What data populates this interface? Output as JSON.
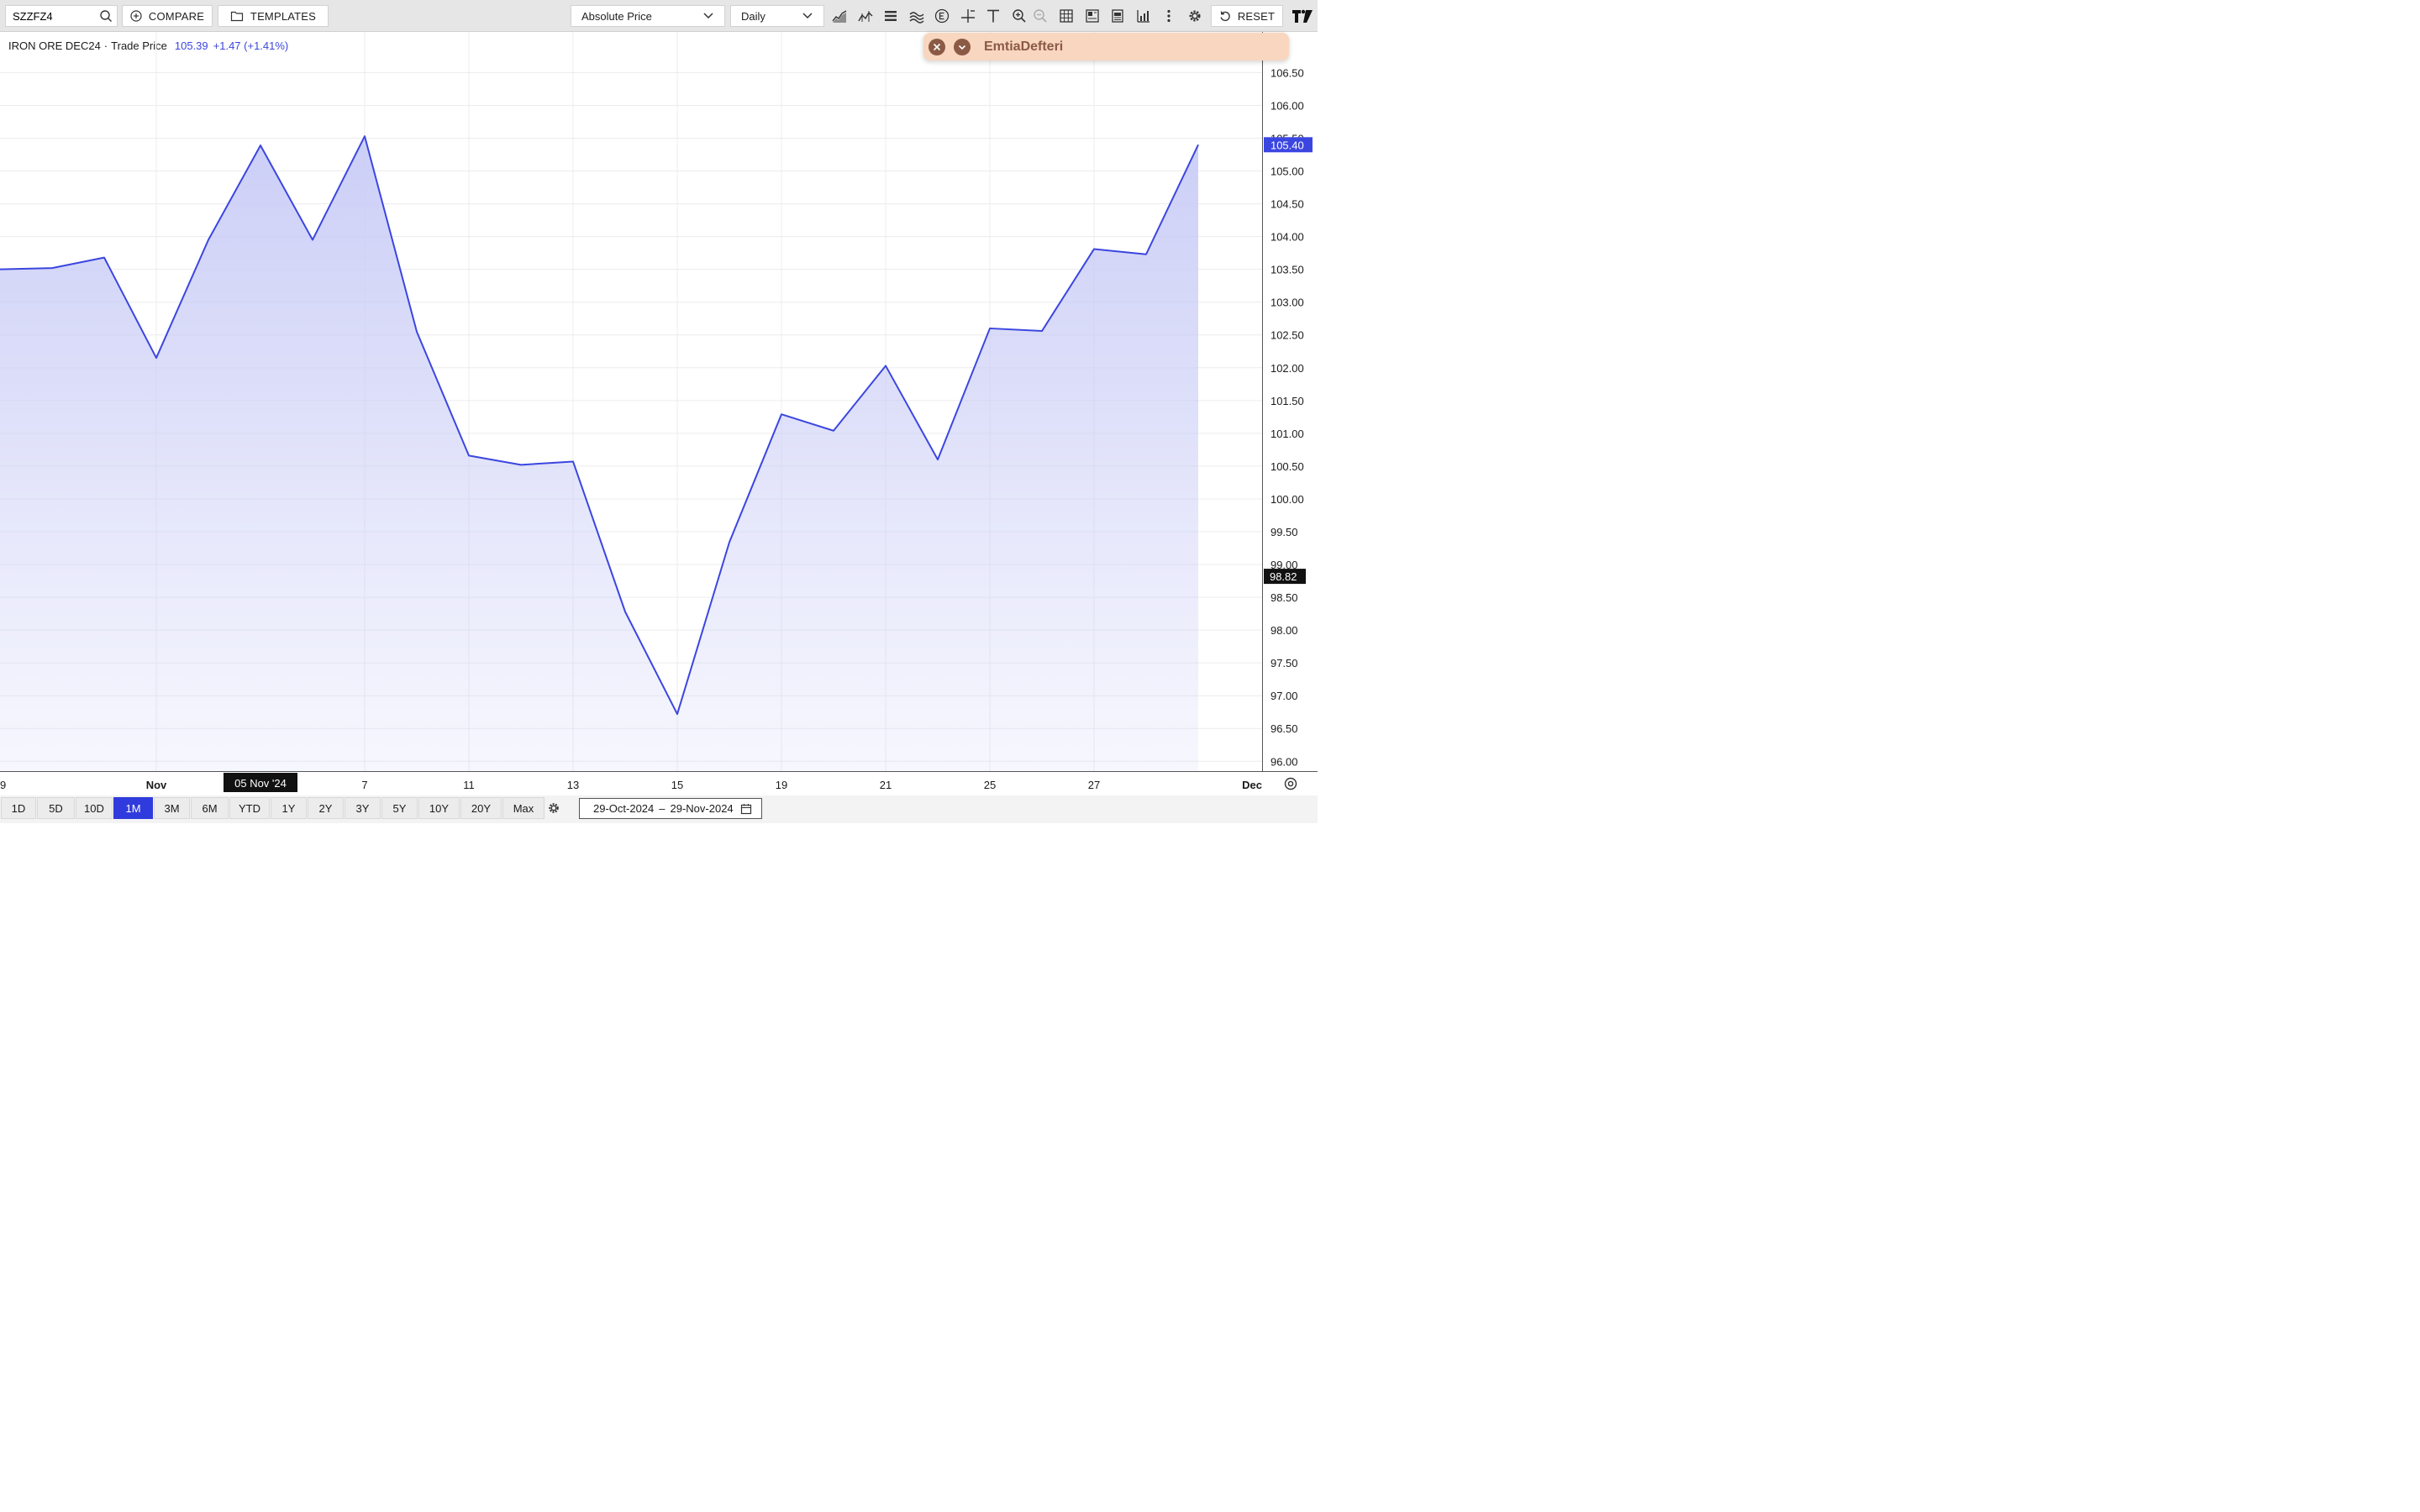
{
  "toolbar": {
    "symbol_value": "SZZFZ4",
    "compare_label": "COMPARE",
    "templates_label": "TEMPLATES",
    "price_mode": "Absolute Price",
    "interval": "Daily",
    "reset_label": "RESET",
    "brand_mark": "TV"
  },
  "legend": {
    "instrument": "IRON ORE DEC24",
    "separator": "·",
    "field": "Trade Price",
    "last": "105.39",
    "change": "+1.47 (+1.41%)"
  },
  "float_panel": {
    "title": "EmtiaDefteri"
  },
  "chart_data": {
    "type": "area",
    "x": [
      "29-Oct",
      "30-Oct",
      "31-Oct",
      "01-Nov",
      "04-Nov",
      "05-Nov",
      "06-Nov",
      "07-Nov",
      "08-Nov",
      "11-Nov",
      "12-Nov",
      "13-Nov",
      "14-Nov",
      "15-Nov",
      "18-Nov",
      "19-Nov",
      "20-Nov",
      "21-Nov",
      "22-Nov",
      "25-Nov",
      "26-Nov",
      "27-Nov",
      "28-Nov",
      "29-Nov"
    ],
    "values": [
      103.5,
      103.52,
      103.68,
      102.15,
      103.95,
      105.39,
      103.95,
      105.53,
      102.55,
      100.66,
      100.52,
      100.57,
      98.28,
      96.72,
      99.34,
      101.29,
      101.04,
      102.03,
      100.6,
      102.6,
      102.56,
      103.81,
      103.73,
      105.4
    ],
    "ylim": [
      95.85,
      107.12
    ],
    "yticks": [
      "106.50",
      "106.00",
      "105.50",
      "105.00",
      "104.50",
      "104.00",
      "103.50",
      "103.00",
      "102.50",
      "102.00",
      "101.50",
      "101.00",
      "100.50",
      "100.00",
      "99.50",
      "99.00",
      "98.50",
      "98.00",
      "97.50",
      "97.00",
      "96.50",
      "96.00"
    ],
    "ytick_values": [
      106.5,
      106.0,
      105.5,
      105.0,
      104.5,
      104.0,
      103.5,
      103.0,
      102.5,
      102.0,
      101.5,
      101.0,
      100.5,
      100.0,
      99.5,
      99.0,
      98.5,
      98.0,
      97.5,
      97.0,
      96.5,
      96.0
    ],
    "xticks": [
      {
        "label": "9",
        "index": -2,
        "bold": false
      },
      {
        "label": "Nov",
        "index": 3,
        "bold": true
      },
      {
        "label": "7",
        "index": 7,
        "bold": false
      },
      {
        "label": "11",
        "index": 9,
        "bold": false
      },
      {
        "label": "13",
        "index": 11,
        "bold": false
      },
      {
        "label": "15",
        "index": 13,
        "bold": false
      },
      {
        "label": "19",
        "index": 15,
        "bold": false
      },
      {
        "label": "21",
        "index": 17,
        "bold": false
      },
      {
        "label": "25",
        "index": 19,
        "bold": false
      },
      {
        "label": "27",
        "index": 21,
        "bold": false
      },
      {
        "label": "Dec",
        "index": 24.3,
        "bold": true
      }
    ],
    "crosshair": {
      "label": "05 Nov '24",
      "index": 5,
      "price": "98.82",
      "price_value": 98.82
    },
    "last_price_label": "105.40",
    "line_color": "#3b46e0",
    "fill_color": "#c9ccf6",
    "grid": true
  },
  "ranges": [
    "1D",
    "5D",
    "10D",
    "1M",
    "3M",
    "6M",
    "YTD",
    "1Y",
    "2Y",
    "3Y",
    "5Y",
    "10Y",
    "20Y",
    "Max"
  ],
  "active_range": "1M",
  "date_range": {
    "start": "29-Oct-2024",
    "separator": "–",
    "end": "29-Nov-2024"
  }
}
